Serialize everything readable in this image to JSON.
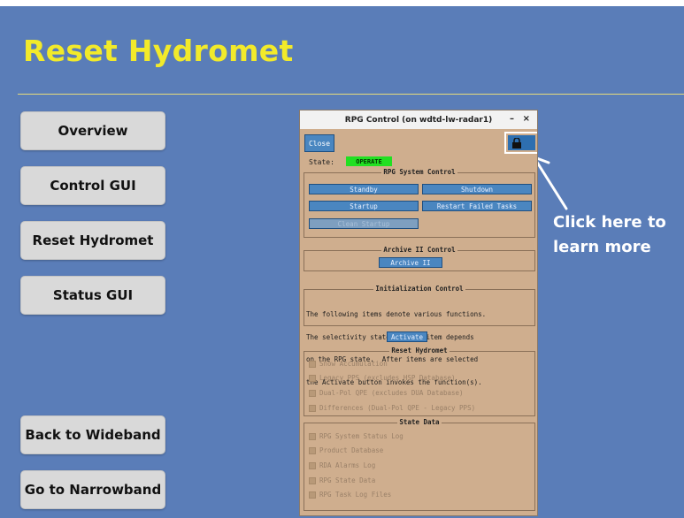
{
  "slide": {
    "title": "Reset Hydromet",
    "callout_line1": "Click here to",
    "callout_line2": "learn more"
  },
  "nav": {
    "overview": "Overview",
    "control_gui": "Control GUI",
    "reset_hydromet": "Reset Hydromet",
    "status_gui": "Status GUI",
    "back_to_wideband": "Back to Wideband",
    "go_to_narrowband": "Go to Narrowband"
  },
  "rpg": {
    "window_title": "RPG Control (on wdtd-lw-radar1)",
    "minimize": "–",
    "close_x": "×",
    "close_button": "Close",
    "lock_icon": "lock-icon",
    "state_label": "State:",
    "state_value": "OPERATE",
    "system_control": {
      "title": "RPG System Control",
      "standby": "Standby",
      "shutdown": "Shutdown",
      "startup": "Startup",
      "restart_failed": "Restart Failed Tasks",
      "clean_startup": "Clean Startup"
    },
    "archive": {
      "title": "Archive II Control",
      "button": "Archive II"
    },
    "init": {
      "title": "Initialization Control",
      "line1": "The following items denote various functions.",
      "line2": "The selectivity state of each item depends",
      "line3": "on the RPG state.  After items are selected",
      "line4": "the Activate button invokes the function(s).",
      "activate": "Activate"
    },
    "reset_hydromet": {
      "title": "Reset Hydromet",
      "items": [
        "Snow Accumulation",
        "Legacy PPS (excludes HSP Database)",
        "Dual-Pol QPE (excludes DUA Database)",
        "Differences (Dual-Pol QPE - Legacy PPS)"
      ]
    },
    "state_data": {
      "title": "State Data",
      "items": [
        "RPG System Status Log",
        "Product Database",
        "RDA Alarms Log",
        "RPG State Data",
        "RPG Task Log Files"
      ]
    }
  },
  "colors": {
    "background": "#5a7db8",
    "title": "#f2ea2a",
    "panel": "#cfae8e",
    "button_blue": "#4a86c0",
    "state_green": "#22e022"
  }
}
